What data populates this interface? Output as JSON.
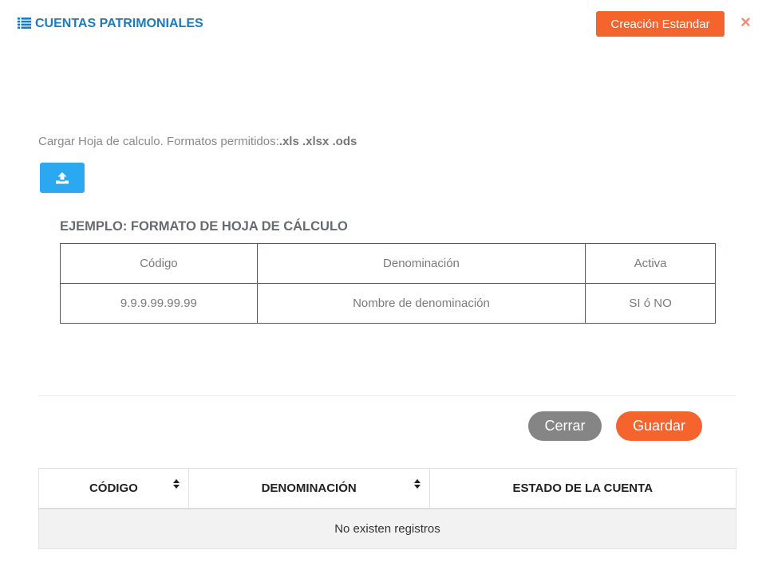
{
  "header": {
    "title": "CUENTAS PATRIMONIALES",
    "title_icon": "list-icon",
    "standard_button": "Creación Estandar",
    "close_label": "×"
  },
  "upload": {
    "text": "Cargar Hoja de calculo. Formatos permitidos:",
    "formats": ".xls .xlsx .ods",
    "button_icon": "upload-icon"
  },
  "example": {
    "title": "EJEMPLO: FORMATO DE HOJA DE CÁLCULO",
    "headers": [
      "Código",
      "Denominación",
      "Activa"
    ],
    "row": [
      "9.9.9.99.99.99",
      "Nombre de denominación",
      "SI ó NO"
    ]
  },
  "actions": {
    "close": "Cerrar",
    "save": "Guardar"
  },
  "records_table": {
    "columns": [
      "CÓDIGO",
      "DENOMINACIÓN",
      "ESTADO DE LA CUENTA"
    ],
    "empty_message": "No existen registros"
  },
  "colors": {
    "accent": "#f4642c",
    "title_blue": "#1a7bbf",
    "upload_blue": "#2aa8f2",
    "close_grey": "#858585"
  }
}
